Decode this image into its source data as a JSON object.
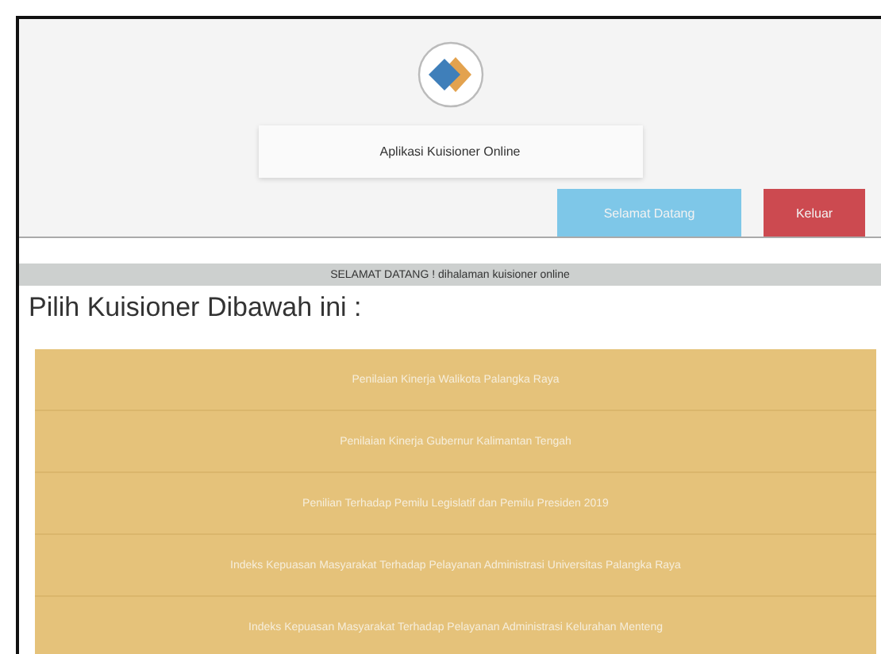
{
  "header": {
    "app_title": "Aplikasi Kuisioner Online",
    "buttons": [
      {
        "label": "Selamat Datang",
        "kind": "info"
      },
      {
        "label": "Keluar",
        "kind": "danger"
      }
    ]
  },
  "banner": "SELAMAT DATANG ! dihalaman kuisioner online",
  "heading": "Pilih Kuisioner Dibawah ini :",
  "questionnaires": [
    {
      "label": "Penilaian Kinerja Walikota Palangka Raya"
    },
    {
      "label": "Penilaian Kinerja Gubernur Kalimantan Tengah"
    },
    {
      "label": "Penilian Terhadap Pemilu Legislatif dan Pemilu Presiden 2019"
    },
    {
      "label": "Indeks Kepuasan Masyarakat Terhadap Pelayanan Administrasi Universitas Palangka Raya"
    },
    {
      "label": "Indeks Kepuasan Masyarakat Terhadap Pelayanan Administrasi Kelurahan Menteng"
    }
  ]
}
